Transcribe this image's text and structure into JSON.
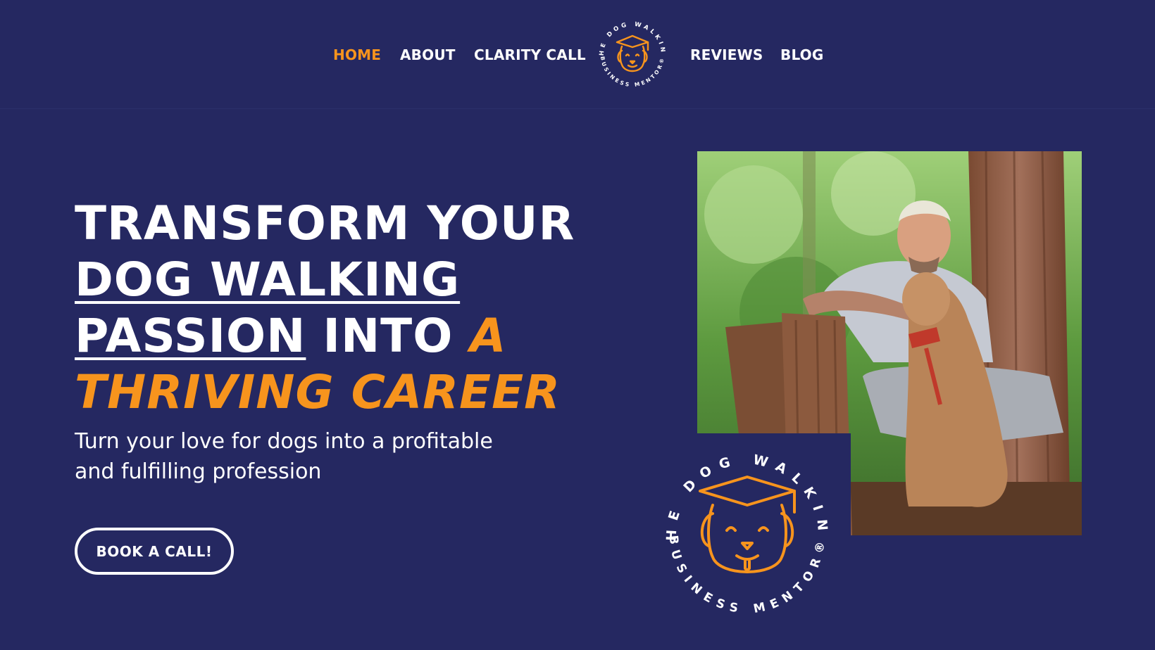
{
  "nav": {
    "items": [
      {
        "label": "HOME",
        "active": true
      },
      {
        "label": "ABOUT",
        "active": false
      },
      {
        "label": "CLARITY CALL",
        "active": false
      },
      {
        "label": "REVIEWS",
        "active": false
      },
      {
        "label": "BLOG",
        "active": false
      }
    ],
    "logo": {
      "top_text": "THE DOG WALKING",
      "bottom_text": "BUSINESS MENTOR®"
    }
  },
  "hero": {
    "headline": {
      "line1": "TRANSFORM YOUR",
      "line2": "DOG WALKING",
      "line3_underlined": "PASSION",
      "line3_rest": " INTO ",
      "line3_accent": "A",
      "line4_accent": "THRIVING CAREER"
    },
    "subheadline": "Turn your love for dogs into a profitable and fulfilling profession",
    "cta_label": "BOOK A CALL!"
  },
  "badge": {
    "top_text": "THE DOG WALKING",
    "bottom_text": "BUSINESS MENTOR®"
  },
  "colors": {
    "background": "#252861",
    "accent": "#f7941d",
    "text": "#ffffff"
  }
}
